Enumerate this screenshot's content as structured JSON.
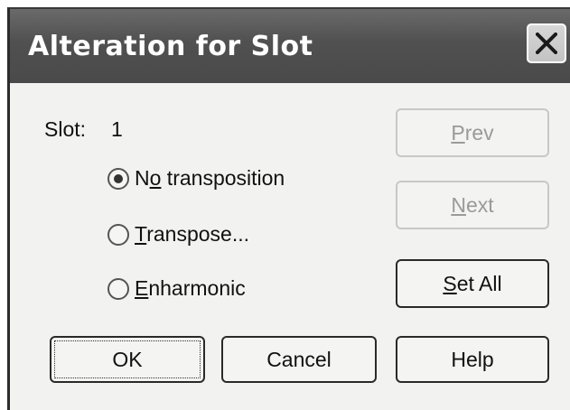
{
  "window": {
    "title": "Alteration for Slot"
  },
  "slot": {
    "label": "Slot:",
    "value": "1"
  },
  "radios": [
    {
      "pre": "N",
      "ul": "o",
      "post": " transposition",
      "checked": true
    },
    {
      "pre": "",
      "ul": "T",
      "post": "ranspose...",
      "checked": false
    },
    {
      "pre": "",
      "ul": "E",
      "post": "nharmonic",
      "checked": false
    }
  ],
  "buttons": {
    "prev": {
      "ul": "P",
      "post": "rev",
      "enabled": false
    },
    "next": {
      "ul": "N",
      "post": "ext",
      "enabled": false
    },
    "set_all": {
      "ul": "S",
      "post": "et All",
      "enabled": true
    },
    "ok": "OK",
    "cancel": "Cancel",
    "help": "Help"
  }
}
